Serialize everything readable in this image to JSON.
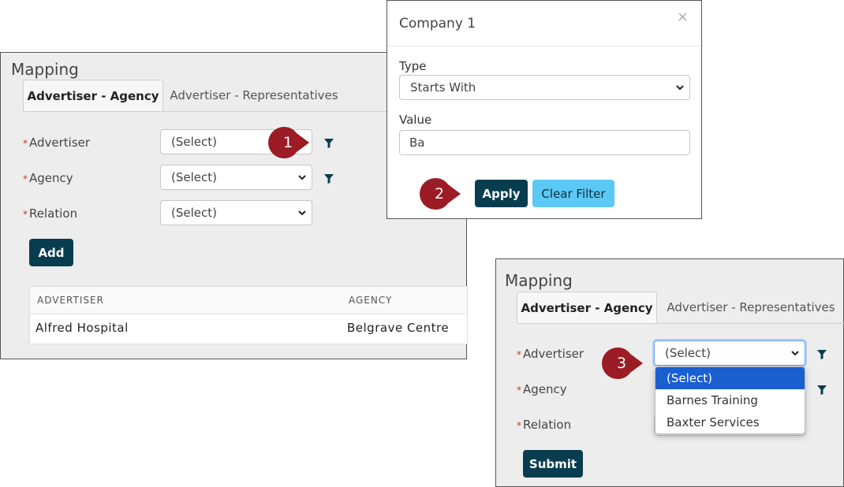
{
  "panel1": {
    "title": "Mapping",
    "tabs": [
      "Advertiser - Agency",
      "Advertiser - Representatives"
    ],
    "fields": [
      {
        "required": "*",
        "label": "Advertiser",
        "value": "(Select)"
      },
      {
        "required": "*",
        "label": "Agency",
        "value": "(Select)"
      },
      {
        "required": "*",
        "label": "Relation",
        "value": "(Select)"
      }
    ],
    "add_label": "Add",
    "table": {
      "headers": [
        "ADVERTISER",
        "AGENCY"
      ],
      "rows": [
        [
          "Alfred Hospital",
          "Belgrave Centre"
        ]
      ]
    }
  },
  "modal": {
    "title": "Company 1",
    "close": "×",
    "type_label": "Type",
    "type_value": "Starts With",
    "value_label": "Value",
    "value_input": "Ba",
    "apply_label": "Apply",
    "clear_label": "Clear Filter"
  },
  "panel2": {
    "title": "Mapping",
    "tabs": [
      "Advertiser - Agency",
      "Advertiser - Representatives"
    ],
    "fields": [
      {
        "required": "*",
        "label": "Advertiser",
        "value": "(Select)"
      },
      {
        "required": "*",
        "label": "Agency"
      },
      {
        "required": "*",
        "label": "Relation"
      }
    ],
    "dropdown_options": [
      "(Select)",
      "Barnes Training",
      "Baxter Services"
    ],
    "selected_index": 0,
    "submit_label": "Submit"
  },
  "callouts": [
    "1",
    "2",
    "3"
  ],
  "colors": {
    "accent_dark": "#083d4f",
    "clear_button": "#5bc8f5",
    "callout": "#9b1c24",
    "required": "#c0392b",
    "option_highlight": "#1a5fd0"
  },
  "icons": [
    "filter-icon",
    "chevron-down-icon",
    "close-icon"
  ]
}
